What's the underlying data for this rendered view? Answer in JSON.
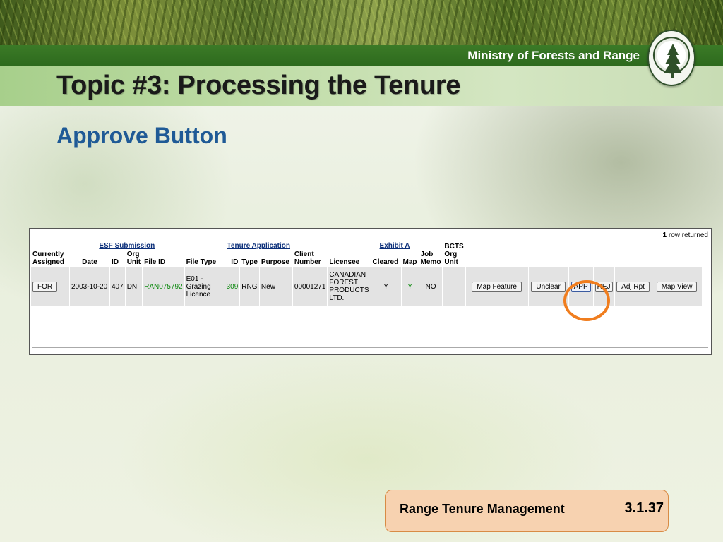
{
  "header": {
    "ministry": "Ministry of Forests and Range",
    "logo_icon": "forest-service-bc-seal"
  },
  "slide": {
    "title": "Topic #3: Processing the Tenure",
    "subtitle": "Approve Button"
  },
  "app": {
    "rows_count": "1",
    "rows_label": "row returned",
    "group_headers": {
      "esf": "ESF Submission",
      "tenure": "Tenure Application",
      "exhibit": "Exhibit A",
      "bcts": "BCTS Org Unit"
    },
    "columns": {
      "currently_assigned": "Currently Assigned",
      "date": "Date",
      "id": "ID",
      "org_unit": "Org Unit",
      "file_id": "File ID",
      "file_type": "File Type",
      "tenure_id": "ID",
      "type": "Type",
      "purpose": "Purpose",
      "client_number": "Client Number",
      "licensee": "Licensee",
      "cleared": "Cleared",
      "map": "Map",
      "job_memo": "Job Memo"
    },
    "row": {
      "assigned_button": "FOR",
      "date": "2003-10-20",
      "id": "407",
      "org_unit": "DNI",
      "file_id": "RAN075792",
      "file_type": "E01 - Grazing Licence",
      "tenure_id": "309",
      "type": "RNG",
      "purpose": "New",
      "client_number": "00001271",
      "licensee": "CANADIAN FOREST PRODUCTS LTD.",
      "cleared": "Y",
      "map": "Y",
      "job_memo": "NO",
      "bcts": ""
    },
    "buttons": {
      "map_feature": "Map Feature",
      "unclear": "Unclear",
      "app": "APP",
      "rej": "REJ",
      "adj_rpt": "Adj Rpt",
      "map_view": "Map View"
    },
    "highlight_color": "#f07d1e"
  },
  "footer": {
    "label": "Range Tenure Management",
    "number": "3.1.37"
  }
}
